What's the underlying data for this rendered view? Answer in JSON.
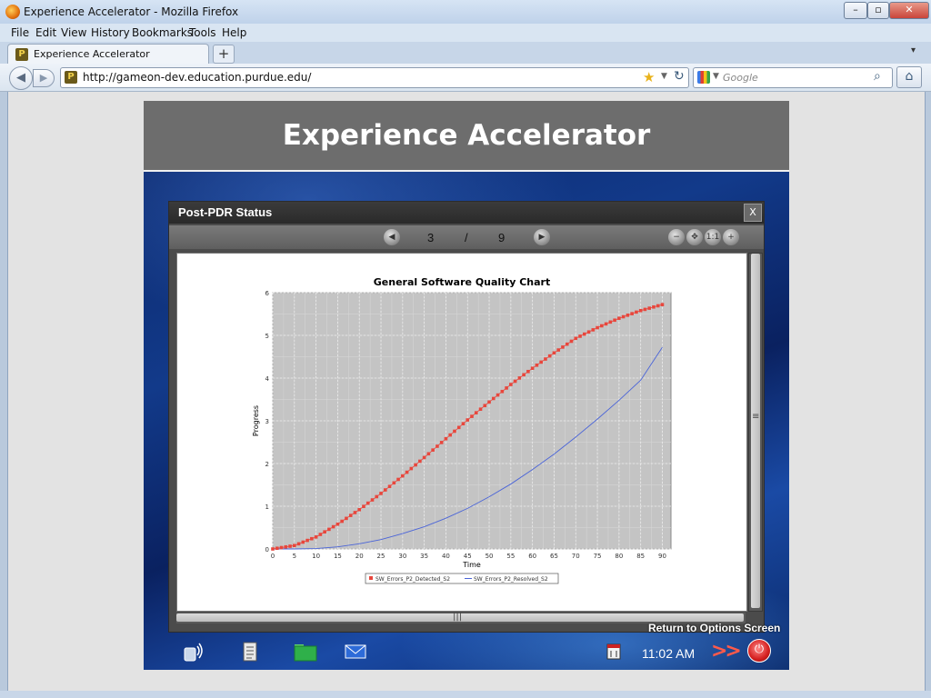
{
  "browser": {
    "window_title": "Experience Accelerator - Mozilla Firefox",
    "menu": [
      "File",
      "Edit",
      "View",
      "History",
      "Bookmarks",
      "Tools",
      "Help"
    ],
    "tab_label": "Experience Accelerator",
    "new_tab": "+",
    "url": "http://gameon-dev.education.purdue.edu/",
    "search_placeholder": "Google"
  },
  "app": {
    "title": "Experience Accelerator",
    "dialog": {
      "title": "Post-PDR Status",
      "close": "X",
      "page_current": "3",
      "page_sep": "/",
      "page_total": "9"
    },
    "return_link": "Return to Options Screen",
    "taskbar": {
      "time": "11:02 AM",
      "arrows": ">>"
    }
  },
  "chart_data": {
    "type": "line",
    "title": "General Software Quality Chart",
    "xlabel": "Time",
    "ylabel": "Progress",
    "xlim": [
      0,
      92
    ],
    "ylim": [
      0,
      6
    ],
    "xticks": [
      0,
      5,
      10,
      15,
      20,
      25,
      30,
      35,
      40,
      45,
      50,
      55,
      60,
      65,
      70,
      75,
      80,
      85,
      90
    ],
    "yticks": [
      0,
      1,
      2,
      3,
      4,
      5,
      6
    ],
    "grid": true,
    "legend_position": "bottom",
    "series": [
      {
        "name": "SW_Errors_P2_Detected_S2",
        "color": "#e8463c",
        "marker": "square",
        "x": [
          0,
          5,
          10,
          15,
          20,
          25,
          30,
          35,
          40,
          45,
          50,
          55,
          60,
          65,
          70,
          75,
          80,
          85,
          90
        ],
        "y": [
          0,
          0.08,
          0.28,
          0.58,
          0.92,
          1.3,
          1.71,
          2.14,
          2.58,
          3.02,
          3.44,
          3.85,
          4.23,
          4.59,
          4.93,
          5.18,
          5.4,
          5.58,
          5.72
        ]
      },
      {
        "name": "SW_Errors_P2_Resolved_S2",
        "color": "#4a64d8",
        "marker": "line",
        "x": [
          0,
          5,
          10,
          15,
          20,
          25,
          30,
          35,
          40,
          45,
          50,
          55,
          60,
          65,
          70,
          75,
          80,
          85,
          90
        ],
        "y": [
          0,
          0.0,
          0.01,
          0.05,
          0.12,
          0.22,
          0.36,
          0.52,
          0.72,
          0.95,
          1.22,
          1.52,
          1.86,
          2.22,
          2.62,
          3.04,
          3.48,
          3.95,
          4.72
        ]
      }
    ]
  }
}
